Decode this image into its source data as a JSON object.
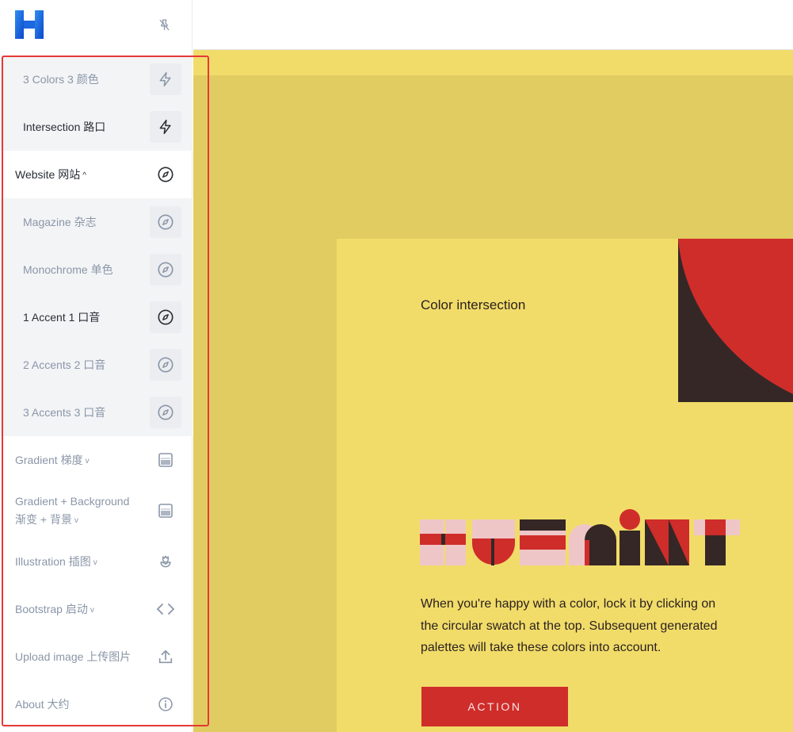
{
  "sidebar": {
    "items": [
      {
        "label": "3 Colors 3 颜色",
        "icon": "bolt-icon"
      },
      {
        "label": "Intersection 路口",
        "icon": "bolt-icon"
      },
      {
        "label": "Website  网站",
        "icon": "compass-icon"
      },
      {
        "label": "Magazine 杂志",
        "icon": "compass-icon"
      },
      {
        "label": "Monochrome 单色",
        "icon": "compass-icon"
      },
      {
        "label": "1 Accent 1 口音",
        "icon": "compass-icon"
      },
      {
        "label": "2 Accents 2 口音",
        "icon": "compass-icon"
      },
      {
        "label": "3 Accents 3 口音",
        "icon": "compass-icon"
      },
      {
        "label": "Gradient  梯度",
        "icon": "gradient-icon"
      },
      {
        "label": "Gradient + Background  渐变 + 背景",
        "icon": "gradient-icon"
      },
      {
        "label": "Illustration  插图",
        "icon": "flower-icon"
      },
      {
        "label": "Bootstrap  启动",
        "icon": "code-icon"
      },
      {
        "label": "Upload image 上传图片",
        "icon": "upload-icon"
      },
      {
        "label": "About 大约",
        "icon": "info-icon"
      }
    ]
  },
  "main": {
    "card_title": "Color intersection",
    "description": "When you're happy with a color, lock it by clicking on the circular swatch at the top. Subsequent generated palettes will take these colors into account.",
    "action_label": "ACTION"
  },
  "colors": {
    "yellow": "#f1dc69",
    "yellow_dark": "#e1cc62",
    "red": "#cf2d2a",
    "dark": "#342726",
    "pink": "#efc6c8",
    "accent_logo": "#1565c0",
    "highlight_box": "#e53935"
  }
}
